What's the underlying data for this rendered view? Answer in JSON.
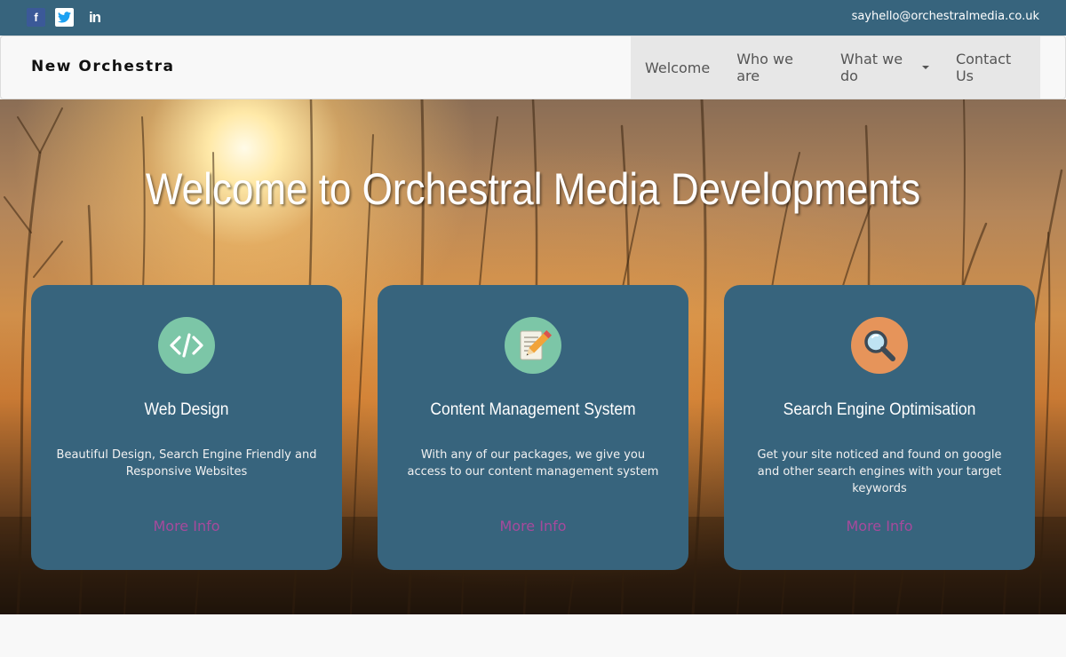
{
  "topbar": {
    "social": [
      {
        "icon": "facebook-icon",
        "glyph": "f"
      },
      {
        "icon": "twitter-icon",
        "glyph": ""
      },
      {
        "icon": "linkedin-icon",
        "glyph": "in"
      }
    ],
    "email": "sayhello@orchestralmedia.co.uk"
  },
  "navbar": {
    "brand": "New Orchestra",
    "items": [
      {
        "label": "Welcome"
      },
      {
        "label": "Who we are"
      },
      {
        "label": "What we do"
      },
      {
        "label": "Contact Us"
      }
    ]
  },
  "hero": {
    "title": "Welcome to Orchestral Media Developments"
  },
  "cards": [
    {
      "icon": "code-icon",
      "icon_color": "#7cc6a7",
      "title": "Web Design",
      "text": "Beautiful Design, Search Engine Friendly and Responsive Websites",
      "link": "More Info"
    },
    {
      "icon": "pencil-document-icon",
      "icon_color": "#7cc6a7",
      "title": "Content Management System",
      "text": "With any of our packages, we give you access to our content management system",
      "link": "More Info"
    },
    {
      "icon": "magnifier-icon",
      "icon_color": "#e6945a",
      "title": "Search Engine Optimisation",
      "text": "Get your site noticed and found on google and other search engines with your target keywords",
      "link": "More Info"
    }
  ],
  "colors": {
    "brand_blue": "#37647d",
    "link_purple": "#a64a9c",
    "nav_bg": "#f8f8f8"
  }
}
